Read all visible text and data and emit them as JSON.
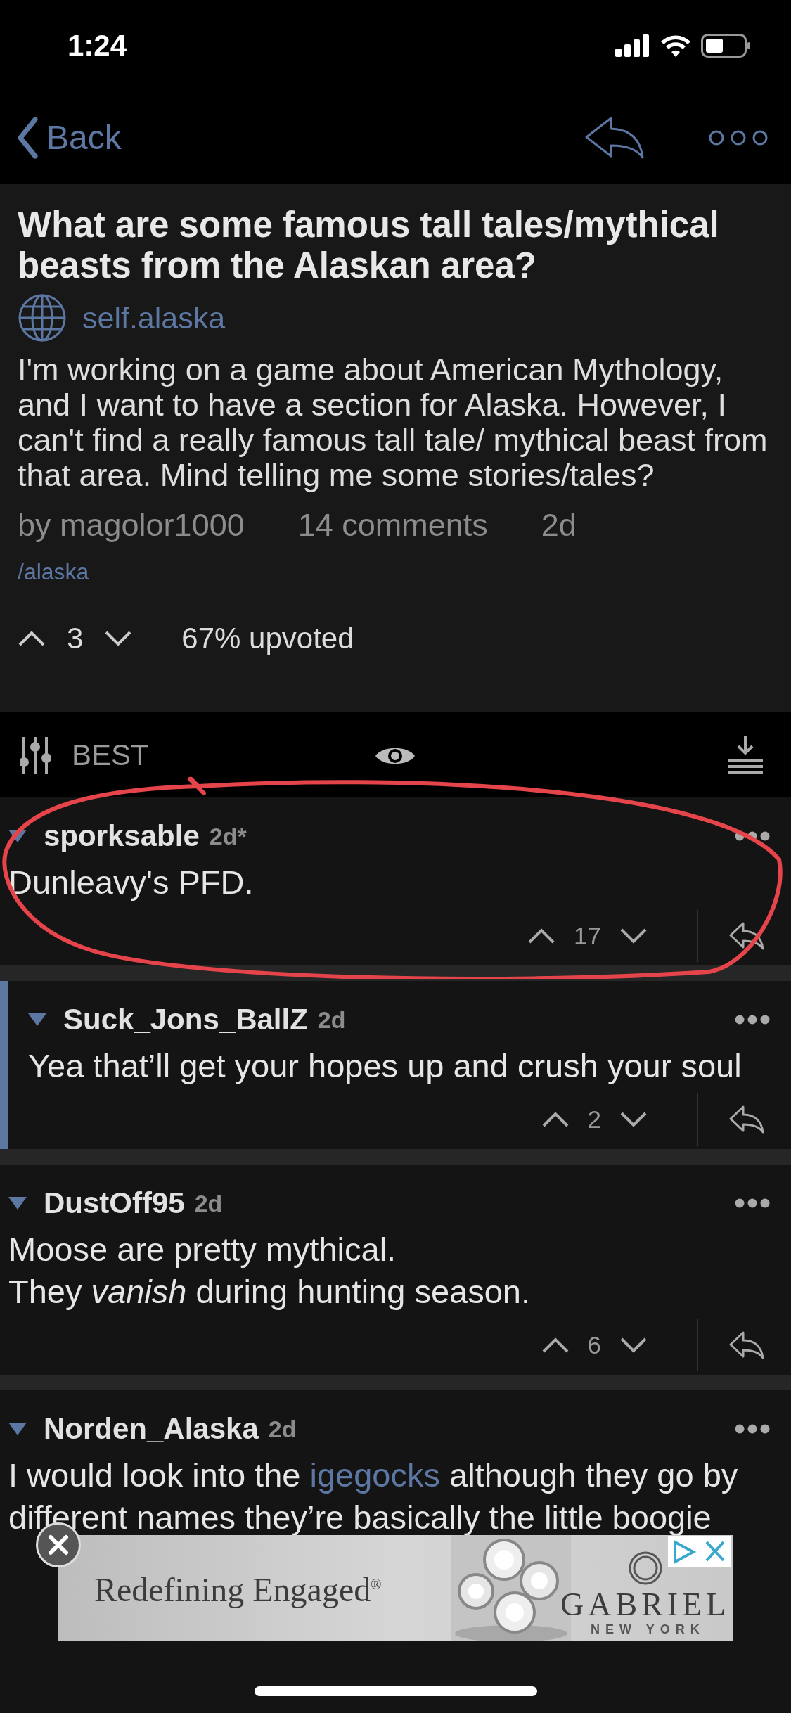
{
  "status_bar": {
    "time": "1:24"
  },
  "nav": {
    "back": "Back"
  },
  "post": {
    "title": "What are some famous tall tales/mythical beasts from the Alaskan area?",
    "domain": "self.alaska",
    "body": "I'm working on a game about American Mythology, and I want to have a section for Alaska. However, I can't find a really famous tall tale/ mythical beast from that area. Mind telling me some stories/tales?",
    "author": "by magolor1000",
    "comments": "14 comments",
    "age": "2d",
    "subreddit": "/alaska",
    "score": "3",
    "upvoted": "67% upvoted"
  },
  "sort_bar": {
    "label": "BEST"
  },
  "comments": [
    {
      "author": "sporksable",
      "age": "2d*",
      "body": [
        {
          "text": "Dunleavy's PFD."
        }
      ],
      "score": "17",
      "annotated": true,
      "children": [
        {
          "author": "Suck_Jons_BallZ",
          "age": "2d",
          "body": [
            {
              "text": "Yea that’ll get your hopes up and crush your soul"
            }
          ],
          "score": "2",
          "annotated": false
        }
      ]
    },
    {
      "author": "DustOff95",
      "age": "2d",
      "body": [
        {
          "text": "Moose are pretty mythical.\nThey *vanish* during hunting season."
        }
      ],
      "score": "6",
      "annotated": false
    },
    {
      "author": "Norden_Alaska",
      "age": "2d",
      "body": [
        {
          "text": "I would look into the "
        },
        {
          "text": "igegocks",
          "link": true
        },
        {
          "text": " although they go by different names they’re basically the little boogie"
        }
      ],
      "annotated": false
    }
  ],
  "ad": {
    "headline": "Redefining Engaged$^{®}$",
    "brand": "GABRIEL",
    "city": "NEW YORK"
  }
}
